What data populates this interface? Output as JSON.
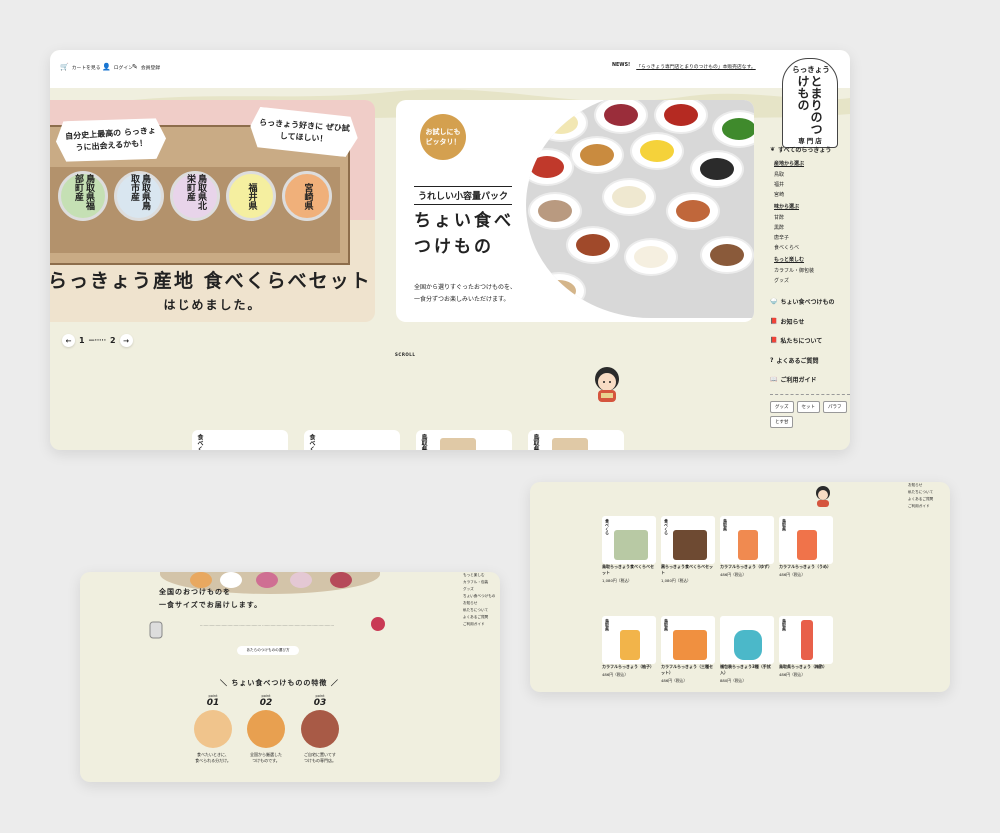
{
  "colors": {
    "cream": "#f0efdf",
    "pink": "#f0cdc8",
    "mustard": "#d4a04f",
    "gray_bg": "#ececec"
  },
  "top_nav": [
    {
      "label": "カートを見る",
      "icon": "cart-icon"
    },
    {
      "label": "ログイン",
      "icon": "person-icon"
    },
    {
      "label": "会員登録",
      "icon": "pencil-icon"
    }
  ],
  "news": {
    "tag": "NEWS!",
    "text": "「らっきょう専門店とまりのつけもの」本販売店なす。"
  },
  "logo": {
    "line1": "らっきょう",
    "line2": "とまりのつけもの",
    "line3": "専門店"
  },
  "slide1": {
    "bubble_left": "自分史上最高の\nらっきょうに出会えるかも！",
    "bubble_right": "らっきょう好きに\nぜひ試してほしい！",
    "jars": [
      "鳥取県福部町産",
      "鳥取県鳥取市産",
      "鳥取県北栄町産",
      "福井県",
      "宮崎県"
    ],
    "title": "らっきょう産地 食べくらべセット",
    "subtitle": "はじめました。"
  },
  "slide2": {
    "circle": "お試しにも\nピッタリ！",
    "label": "うれしい小容量パック",
    "title": "ちょい食べ\nつけもの",
    "desc": "全国から選りすぐったおつけものを、\n一食分ずつお楽しみいただけます。"
  },
  "pager": {
    "prev": "←",
    "current": "1",
    "total": "2",
    "next": "→"
  },
  "scroll_label": "SCROLL",
  "sidebar": {
    "all": "すべてのらっきょう",
    "groups": [
      {
        "title": "産地から選ぶ",
        "items": [
          "鳥取",
          "福井",
          "宮崎"
        ]
      },
      {
        "title": "味から選ぶ",
        "items": [
          "甘酢",
          "黒酢",
          "唐辛子",
          "食べくらべ"
        ]
      },
      {
        "title": "もっと楽しむ",
        "items": [
          "カラフル・御包装",
          "グッズ"
        ]
      }
    ],
    "links": [
      {
        "label": "ちょい食べつけもの",
        "icon": "bowl-icon"
      },
      {
        "label": "お知らせ",
        "icon": "book-icon"
      },
      {
        "label": "私たちについて",
        "icon": "book-icon"
      },
      {
        "label": "よくあるご質問",
        "icon": "question-icon"
      },
      {
        "label": "ご利用ガイド",
        "icon": "book-open-icon"
      }
    ],
    "tags": [
      "グッズ",
      "セット",
      "パラフ",
      "とす甘"
    ]
  },
  "product_strip": [
    "食べくら",
    "食べくら",
    "鳥取県",
    "鳥取県"
  ],
  "left_panel": {
    "title": "全国のおつけものを\n一食サイズでお届けします。",
    "button": "あたらのつけものの選び方",
    "features_heading": "＼ ちょい食べつけものの特徴 ／",
    "points": [
      {
        "label": "point",
        "num": "01",
        "cap": "食べたいときに、\n食べられる分だけ。"
      },
      {
        "label": "point",
        "num": "02",
        "cap": "全国から厳選した\nつけものです。"
      },
      {
        "label": "point",
        "num": "03",
        "cap": "ご自宅に置いてす\nつけもの専門店。"
      }
    ],
    "side": [
      "もっと楽しむ",
      "カラフル・包装",
      "グッズ",
      "ちょい食べつけもの",
      "お知らせ",
      "私たちについて",
      "よくあるご質問",
      "ご利用ガイド"
    ]
  },
  "right_panel": {
    "products": [
      {
        "tag": "食べくら",
        "name": "鳥取らっきょう食べくらべセット",
        "price": "1,080円（税込）",
        "jar": "#b8c9a4"
      },
      {
        "tag": "食べくら",
        "name": "黒らっきょう食べくらべセット",
        "price": "1,080円（税込）",
        "jar": "#6e4a32"
      },
      {
        "tag": "鳥取県",
        "name": "カラフルらっきょう（ゆず）",
        "price": "486円（税込）",
        "jar": "#f08a50"
      },
      {
        "tag": "鳥取県",
        "name": "カラフルらっきょう（うめ）",
        "price": "486円（税込）",
        "jar": "#f0734a"
      },
      {
        "tag": "鳥取県",
        "name": "カラフルらっきょう（柚子）",
        "price": "486円（税込）",
        "jar": "#f2b44a"
      },
      {
        "tag": "鳥取県",
        "name": "カラフルらっきょう（三種セット）",
        "price": "486円（税込）",
        "jar": "#f09040"
      },
      {
        "tag": "",
        "name": "福包装らっきょう3種（手拭入）",
        "price": "880円（税込）",
        "jar": "#4bb8c9"
      },
      {
        "tag": "鳥取県",
        "name": "鳥取県らっきょう（梅酢）",
        "price": "486円（税込）",
        "jar": "#e8604a"
      }
    ],
    "side": [
      "お知らせ",
      "私たちについて",
      "よくあるご質問",
      "ご利用ガイド"
    ]
  }
}
